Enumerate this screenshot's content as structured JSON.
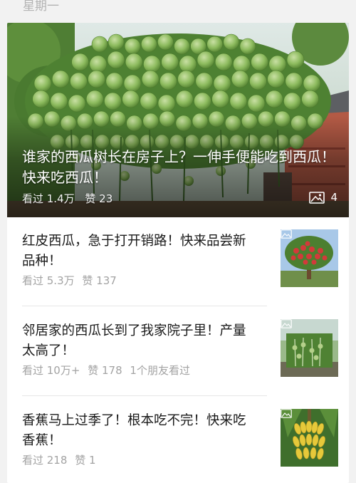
{
  "header": {
    "day": "星期一"
  },
  "featured": {
    "title": "谁家的西瓜树长在房子上？一伸手便能吃到西瓜！快来吃西瓜！",
    "views": "看过 1.4万",
    "likes": "赞 23",
    "image_count": "4",
    "image_icon": "image-icon"
  },
  "articles": [
    {
      "title": "红皮西瓜，急于打开销路！快来品尝新品种！",
      "views": "看过 5.3万",
      "likes": "赞 137",
      "friends": "",
      "thumb_icon": "image-icon"
    },
    {
      "title": "邻居家的西瓜长到了我家院子里！产量太高了！",
      "views": "看过 10万+",
      "likes": "赞 178",
      "friends": "1个朋友看过",
      "thumb_icon": "image-icon"
    },
    {
      "title": "香蕉马上过季了！根本吃不完！快来吃香蕉！",
      "views": "看过 218",
      "likes": "赞 1",
      "friends": "",
      "thumb_icon": "image-icon"
    }
  ],
  "colors": {
    "card": "#ffffff",
    "page": "#f2f2f2",
    "meta": "#a3a3a3",
    "title": "#1a1a1a"
  }
}
